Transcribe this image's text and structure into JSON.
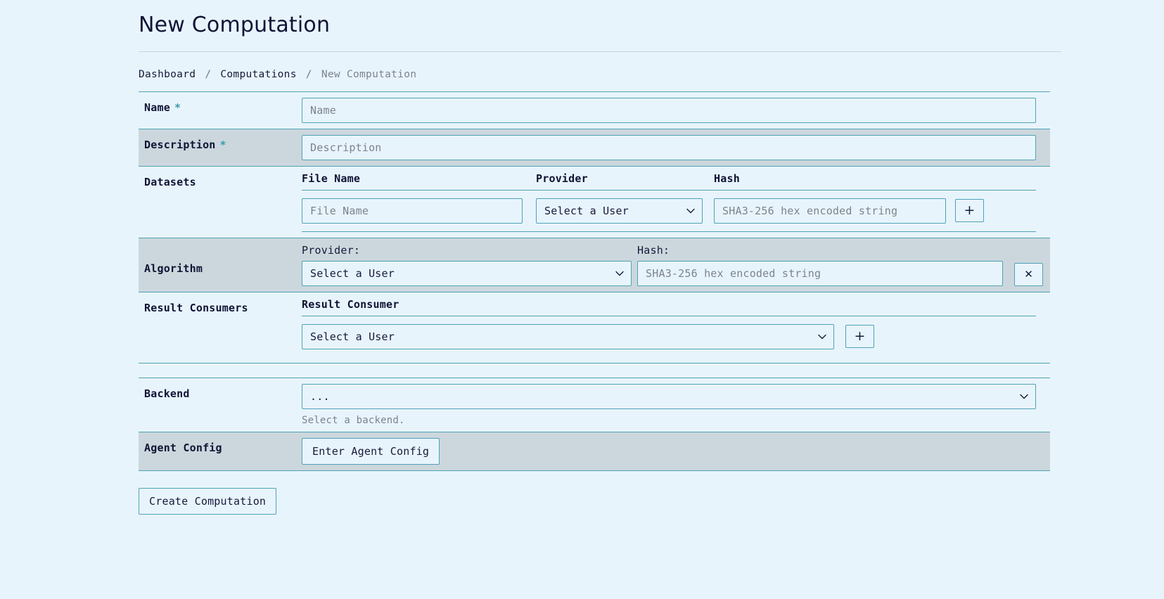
{
  "header": {
    "title": "New Computation"
  },
  "breadcrumb": {
    "items": [
      {
        "label": "Dashboard",
        "current": false
      },
      {
        "label": "Computations",
        "current": false
      },
      {
        "label": "New Computation",
        "current": true
      }
    ],
    "separator": "/"
  },
  "form": {
    "name": {
      "label": "Name",
      "required_marker": "*",
      "placeholder": "Name",
      "value": ""
    },
    "description": {
      "label": "Description",
      "required_marker": "*",
      "placeholder": "Description",
      "value": ""
    },
    "datasets": {
      "label": "Datasets",
      "columns": [
        "File Name",
        "Provider",
        "Hash"
      ],
      "rows": [
        {
          "file_name_placeholder": "File Name",
          "file_name_value": "",
          "provider_selected": "Select a User",
          "hash_placeholder": "SHA3-256 hex encoded string",
          "hash_value": "",
          "add_button_label": "+"
        }
      ]
    },
    "algorithm": {
      "label": "Algorithm",
      "provider_label": "Provider:",
      "provider_selected": "Select a User",
      "hash_label": "Hash:",
      "hash_placeholder": "SHA3-256 hex encoded string",
      "hash_value": "",
      "remove_button_label": "✕"
    },
    "result_consumers": {
      "label": "Result Consumers",
      "column": "Result Consumer",
      "selected": "Select a User",
      "add_button_label": "+"
    },
    "backend": {
      "label": "Backend",
      "selected": "...",
      "help": "Select a backend."
    },
    "agent_config": {
      "label": "Agent Config",
      "button_label": "Enter Agent Config"
    },
    "submit": {
      "label": "Create Computation"
    }
  },
  "colors": {
    "page_background": "#e8f4fc",
    "alt_row_background": "#ccd7dd",
    "border_accent": "#4da3b6",
    "text_primary": "#16193b",
    "text_muted": "#7a848f",
    "required_star": "#3a9aa8"
  }
}
